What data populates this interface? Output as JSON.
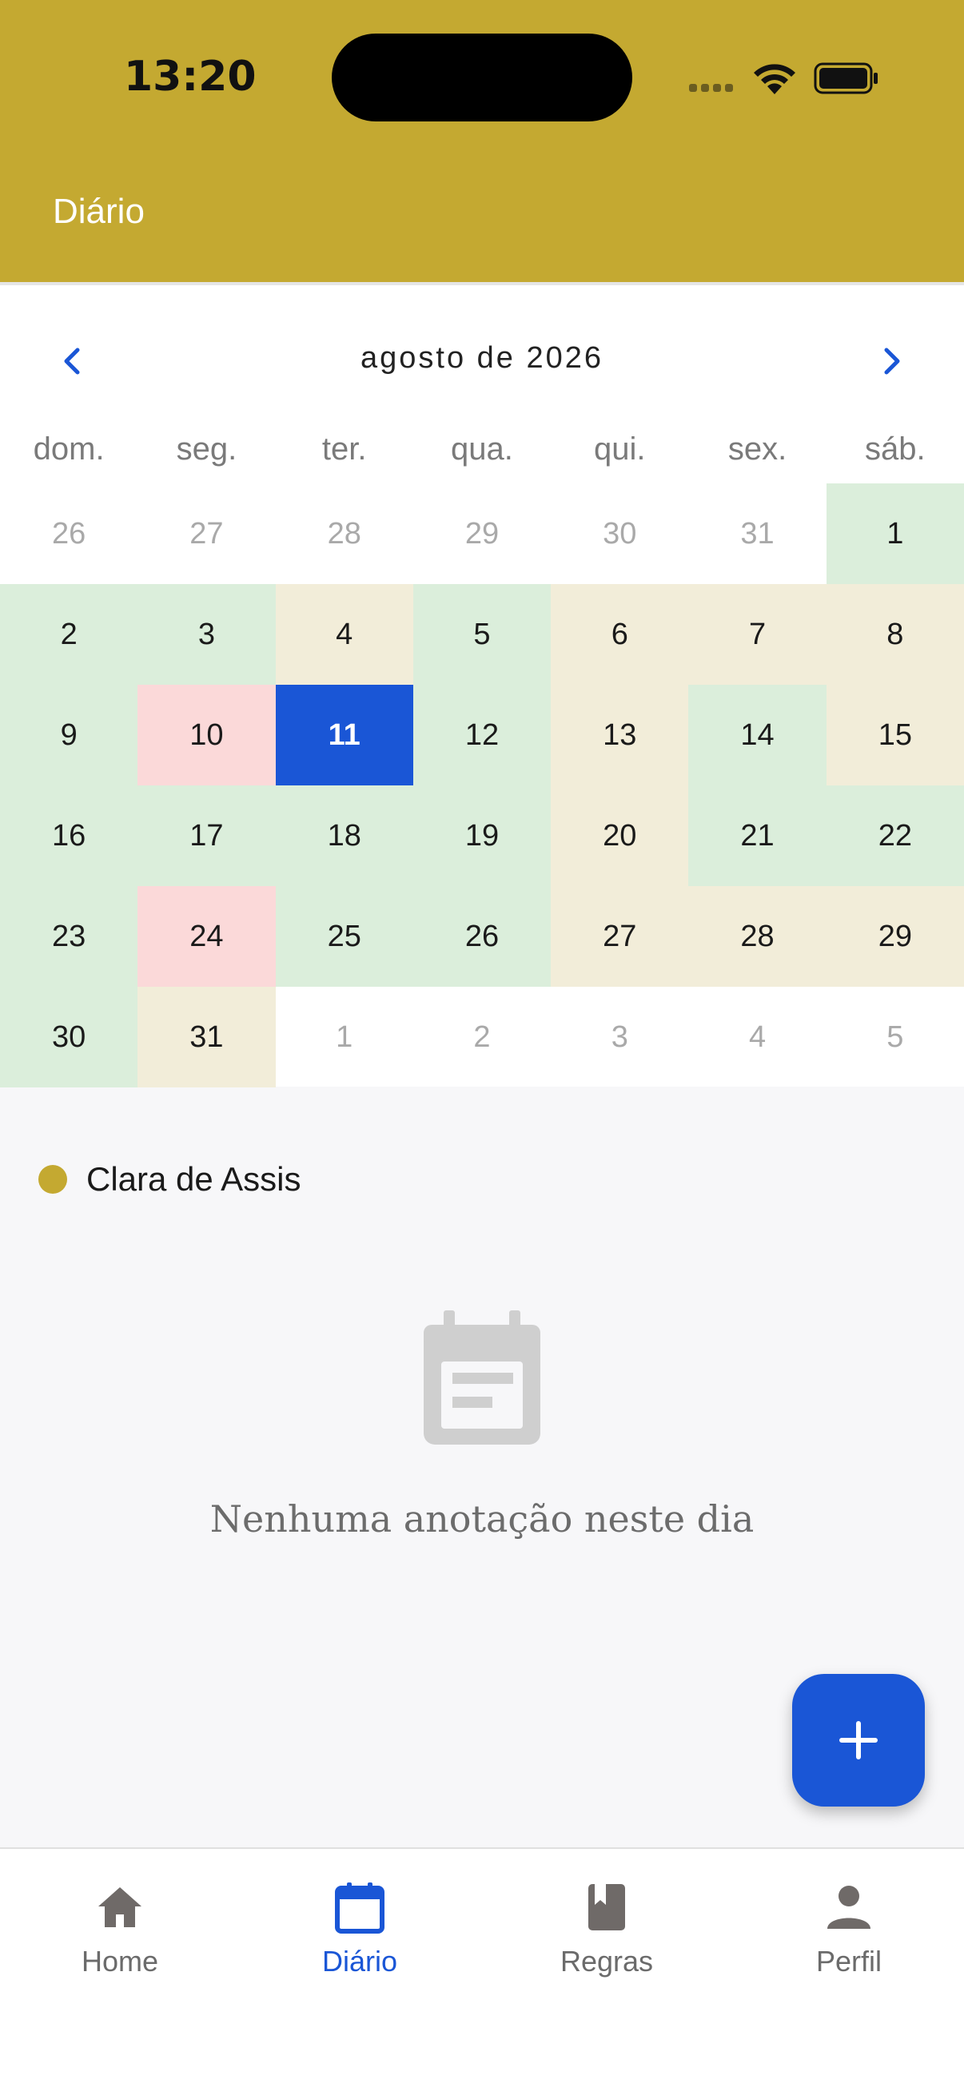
{
  "status_bar": {
    "time": "13:20"
  },
  "header": {
    "title": "Diário"
  },
  "calendar": {
    "month_title": "agosto de 2026",
    "weekdays": [
      "dom.",
      "seg.",
      "ter.",
      "qua.",
      "qui.",
      "sex.",
      "sáb."
    ],
    "weeks": [
      [
        {
          "d": "26",
          "s": "out"
        },
        {
          "d": "27",
          "s": "out"
        },
        {
          "d": "28",
          "s": "out"
        },
        {
          "d": "29",
          "s": "out"
        },
        {
          "d": "30",
          "s": "out"
        },
        {
          "d": "31",
          "s": "out"
        },
        {
          "d": "1",
          "s": "g"
        }
      ],
      [
        {
          "d": "2",
          "s": "g"
        },
        {
          "d": "3",
          "s": "g"
        },
        {
          "d": "4",
          "s": "y"
        },
        {
          "d": "5",
          "s": "g"
        },
        {
          "d": "6",
          "s": "y"
        },
        {
          "d": "7",
          "s": "y"
        },
        {
          "d": "8",
          "s": "y"
        }
      ],
      [
        {
          "d": "9",
          "s": "g"
        },
        {
          "d": "10",
          "s": "p"
        },
        {
          "d": "11",
          "s": "sel"
        },
        {
          "d": "12",
          "s": "g"
        },
        {
          "d": "13",
          "s": "y"
        },
        {
          "d": "14",
          "s": "g"
        },
        {
          "d": "15",
          "s": "y"
        }
      ],
      [
        {
          "d": "16",
          "s": "g"
        },
        {
          "d": "17",
          "s": "g"
        },
        {
          "d": "18",
          "s": "g"
        },
        {
          "d": "19",
          "s": "g"
        },
        {
          "d": "20",
          "s": "y"
        },
        {
          "d": "21",
          "s": "g"
        },
        {
          "d": "22",
          "s": "g"
        }
      ],
      [
        {
          "d": "23",
          "s": "g"
        },
        {
          "d": "24",
          "s": "p"
        },
        {
          "d": "25",
          "s": "g"
        },
        {
          "d": "26",
          "s": "g"
        },
        {
          "d": "27",
          "s": "y"
        },
        {
          "d": "28",
          "s": "y"
        },
        {
          "d": "29",
          "s": "y"
        }
      ],
      [
        {
          "d": "30",
          "s": "g"
        },
        {
          "d": "31",
          "s": "y"
        },
        {
          "d": "1",
          "s": "out"
        },
        {
          "d": "2",
          "s": "out"
        },
        {
          "d": "3",
          "s": "out"
        },
        {
          "d": "4",
          "s": "out"
        },
        {
          "d": "5",
          "s": "out"
        }
      ]
    ]
  },
  "legend": {
    "name": "Clara de Assis",
    "color": "#c4a931"
  },
  "empty_state": {
    "message": "Nenhuma anotação neste dia",
    "icon": "calendar-note-icon"
  },
  "fab": {
    "icon": "plus-icon"
  },
  "bottom_nav": {
    "items": [
      {
        "label": "Home",
        "icon": "home-icon",
        "active": false
      },
      {
        "label": "Diário",
        "icon": "calendar-icon",
        "active": true
      },
      {
        "label": "Regras",
        "icon": "book-icon",
        "active": false
      },
      {
        "label": "Perfil",
        "icon": "person-icon",
        "active": false
      }
    ]
  },
  "colors": {
    "accent": "#1a56d6",
    "brand": "#c4a931",
    "green_day": "#dbeedb",
    "yellow_day": "#f2edd9",
    "pink_day": "#fbd9d9"
  }
}
